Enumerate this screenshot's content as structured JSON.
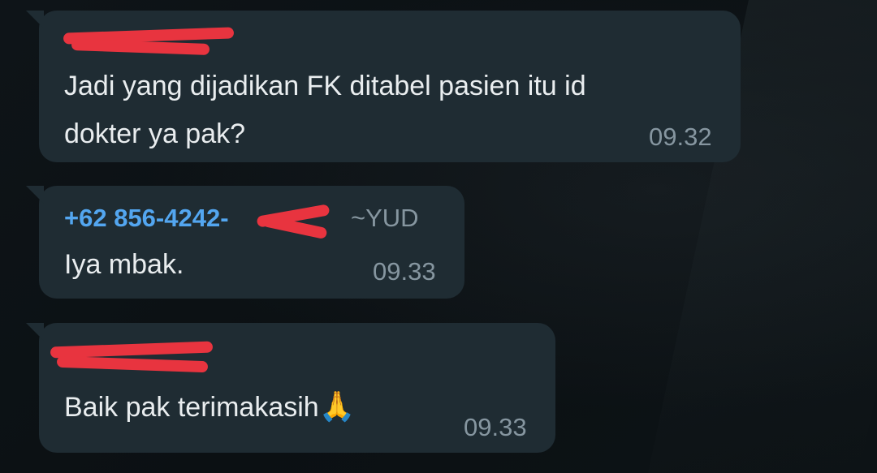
{
  "messages": [
    {
      "sender": "",
      "text_line1": "Jadi yang dijadikan FK ditabel pasien itu id",
      "text_line2": "dokter ya pak?",
      "time": "09.32"
    },
    {
      "sender_phone": "+62 856-4242-",
      "sender_name": "~YUD",
      "text": "Iya mbak.",
      "time": "09.33"
    },
    {
      "sender": "",
      "text": "Baik pak terimakasih",
      "emoji": "🙏",
      "time": "09.33"
    }
  ],
  "colors": {
    "bubble": "#1f2c33",
    "text": "#e9edef",
    "time": "#8696a0",
    "sender_phone": "#53a6f0",
    "redaction": "#e8343f"
  }
}
